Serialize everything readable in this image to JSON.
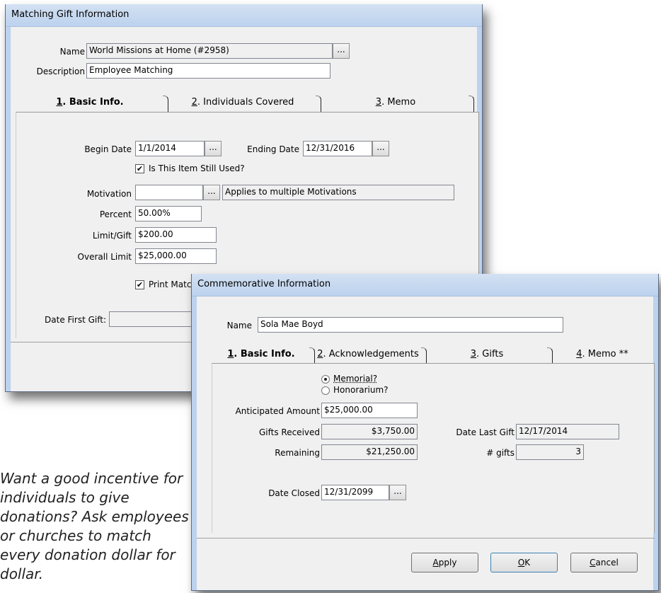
{
  "matching": {
    "title": "Matching Gift Information",
    "name_label": "Name",
    "name_value": "World Missions at Home (#2958)",
    "description_label": "Description",
    "description_value": "Employee Matching",
    "tabs": [
      {
        "num": "1",
        "rest": ". Basic Info."
      },
      {
        "num": "2",
        "rest": ". Individuals Covered"
      },
      {
        "num": "3",
        "rest": ". Memo"
      }
    ],
    "begin_date_label": "Begin Date",
    "begin_date_value": "1/1/2014",
    "ending_date_label": "Ending Date",
    "ending_date_value": "12/31/2016",
    "still_used_label": "Is This Item Still Used?",
    "motivation_label": "Motivation",
    "motivation_value": "",
    "motivation_desc": "Applies to multiple Motivations",
    "percent_label": "Percent",
    "percent_value": "50.00%",
    "limit_gift_label": "Limit/Gift",
    "limit_gift_value": "$200.00",
    "overall_limit_label": "Overall Limit",
    "overall_limit_value": "$25,000.00",
    "print_label": "Print Matc",
    "date_first_gift_label": "Date First Gift:",
    "date_first_gift_value": ""
  },
  "commemorative": {
    "title": "Commemorative Information",
    "name_label": "Name",
    "name_value": "Sola Mae Boyd",
    "tabs": [
      {
        "num": "1",
        "rest": ". Basic Info."
      },
      {
        "num": "2",
        "rest": ". Acknowledgements"
      },
      {
        "num": "3",
        "rest": ". Gifts"
      },
      {
        "num": "4",
        "rest": ". Memo **"
      }
    ],
    "memorial_label": "Memorial?",
    "honorarium_label": "Honorarium?",
    "anticipated_label": "Anticipated Amount",
    "anticipated_value": "$25,000.00",
    "gifts_received_label": "Gifts Received",
    "gifts_received_value": "$3,750.00",
    "remaining_label": "Remaining",
    "remaining_value": "$21,250.00",
    "date_last_gift_label": "Date Last Gift",
    "date_last_gift_value": "12/17/2014",
    "num_gifts_label": "# gifts",
    "num_gifts_value": "3",
    "date_closed_label": "Date Closed",
    "date_closed_value": "12/31/2099",
    "apply_u": "A",
    "apply_rest": "pply",
    "ok_u": "O",
    "ok_rest": "K",
    "cancel_u": "C",
    "cancel_rest": "ancel"
  },
  "caption": "Want a good incentive for individuals to give donations? Ask employees or churches to match every donation dollar for dollar.",
  "ellipsis": "...",
  "check_mark": "✔"
}
